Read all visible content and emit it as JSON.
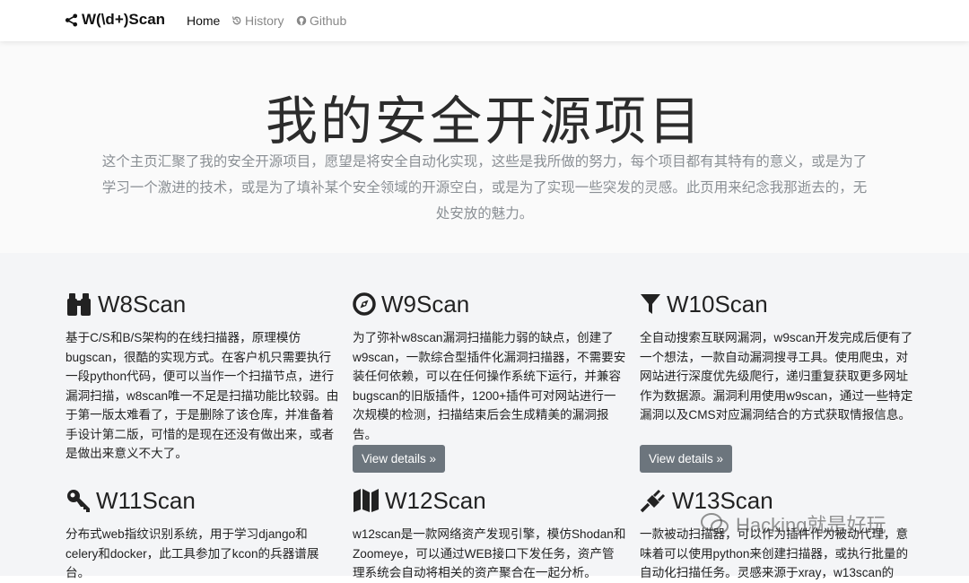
{
  "navbar": {
    "brand": "W(\\d+)Scan",
    "links": [
      {
        "label": "Home",
        "active": true
      },
      {
        "label": "History",
        "icon": "history-icon"
      },
      {
        "label": "Github",
        "icon": "github-icon"
      }
    ]
  },
  "hero": {
    "title": "我的安全开源项目",
    "lead": "这个主页汇聚了我的安全开源项目，愿望是将安全自动化实现，这些是我所做的努力，每个项目都有其特有的意义，或是为了学习一个激进的技术，或是为了填补某个安全领域的开源空白，或是为了实现一些突发的灵感。此页用来纪念我那逝去的，无处安放的魅力。"
  },
  "projects": [
    {
      "title": "W8Scan",
      "icon": "binoculars-icon",
      "desc": "基于C/S和B/S架构的在线扫描器，原理模仿bugscan，很酷的实现方式。在客户机只需要执行一段python代码，便可以当作一个扫描节点，进行漏洞扫描，w8scan唯一不足是扫描功能比较弱。由于第一版太难看了，于是删除了该仓库，并准备着手设计第二版，可惜的是现在还没有做出来，或者是做出来意义不大了。"
    },
    {
      "title": "W9Scan",
      "icon": "compass-icon",
      "desc": "为了弥补w8scan漏洞扫描能力弱的缺点，创建了w9scan，一款综合型插件化漏洞扫描器，不需要安装任何依赖，可以在任何操作系统下运行，并兼容bugscan的旧版插件，1200+插件可对网站进行一次规模的检测，扫描结束后会生成精美的漏洞报告。",
      "button": "View details »"
    },
    {
      "title": "W10Scan",
      "icon": "filter-icon",
      "desc": "全自动搜索互联网漏洞，w9scan开发完成后便有了一个想法，一款自动漏洞搜寻工具。使用爬虫，对网站进行深度优先级爬行，递归重复获取更多网址作为数据源。漏洞利用使用w9scan，通过一些特定漏洞以及CMS对应漏洞结合的方式获取情报信息。",
      "button": "View details »"
    },
    {
      "title": "W11Scan",
      "icon": "key-icon",
      "desc": "分布式web指纹识别系统，用于学习django和celery和docker，此工具参加了kcon的兵器谱展台。"
    },
    {
      "title": "W12Scan",
      "icon": "map-icon",
      "desc": "w12scan是一款网络资产发现引擎，模仿Shodan和Zoomeye，可以通过WEB接口下发任务，资产管理系统会自动将相关的资产聚合在一起分析。"
    },
    {
      "title": "W13Scan",
      "icon": "plug-icon",
      "desc": "一款被动扫描器，可以作为插件作为被动代理，意味着可以使用python来创建扫描器，或执行批量的自动化扫描任务。灵感来源于xray，w13scan的"
    }
  ],
  "watermark": "Hacking就是好玩",
  "colors": {
    "button_bg": "#6c757d",
    "hero_bg": "#fafafa",
    "content_bg": "#f4f5f7",
    "lead_text": "#8a8f94"
  }
}
